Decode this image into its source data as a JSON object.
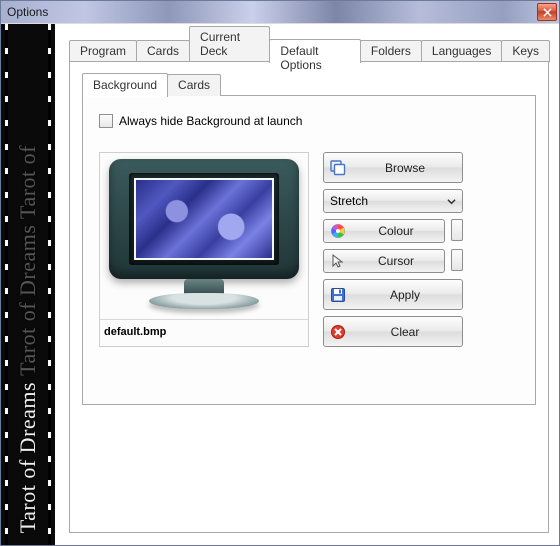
{
  "window": {
    "title": "Options"
  },
  "sidebar": {
    "text_bright": "Tarot of Dreams",
    "text_dim": "Tarot of Dreams  Tarot of"
  },
  "tabs": {
    "items": [
      {
        "label": "Program"
      },
      {
        "label": "Cards"
      },
      {
        "label": "Current Deck"
      },
      {
        "label": "Default Options"
      },
      {
        "label": "Folders"
      },
      {
        "label": "Languages"
      },
      {
        "label": "Keys"
      }
    ],
    "active_index": 3
  },
  "inner_tabs": {
    "items": [
      {
        "label": "Background"
      },
      {
        "label": "Cards"
      }
    ],
    "active_index": 0
  },
  "background_page": {
    "checkbox_label": "Always hide Background at launch",
    "checkbox_checked": false,
    "filename": "default.bmp",
    "scale_mode": {
      "selected": "Stretch"
    },
    "buttons": {
      "browse": "Browse",
      "colour": "Colour",
      "cursor": "Cursor",
      "apply": "Apply",
      "clear": "Clear"
    }
  }
}
